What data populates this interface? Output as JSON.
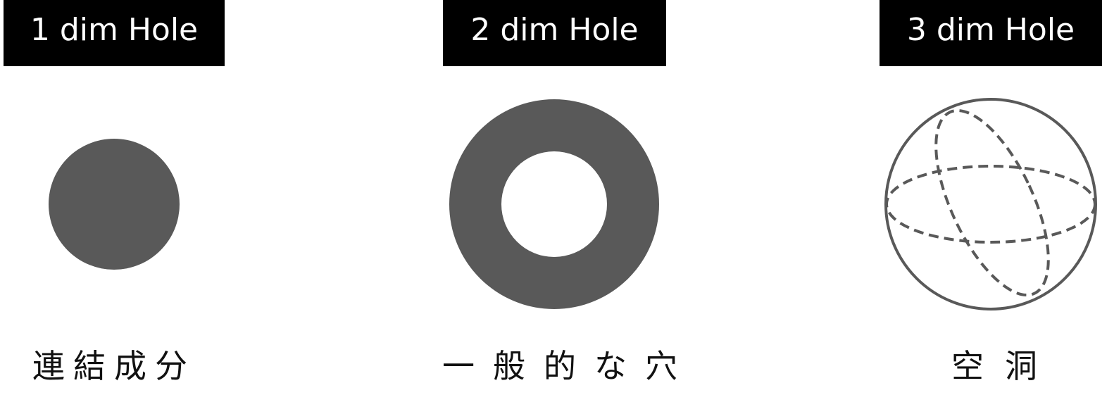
{
  "panels": [
    {
      "title": "1 dim Hole",
      "caption": "連結成分",
      "shape": "filled-disk"
    },
    {
      "title": "2 dim Hole",
      "caption": "一般的な穴",
      "shape": "ring"
    },
    {
      "title": "3 dim Hole",
      "caption": "空洞",
      "shape": "hollow-sphere"
    }
  ],
  "colors": {
    "shape_fill": "#595959",
    "title_background": "#000000",
    "title_text": "#ffffff",
    "caption_text": "#111111"
  }
}
